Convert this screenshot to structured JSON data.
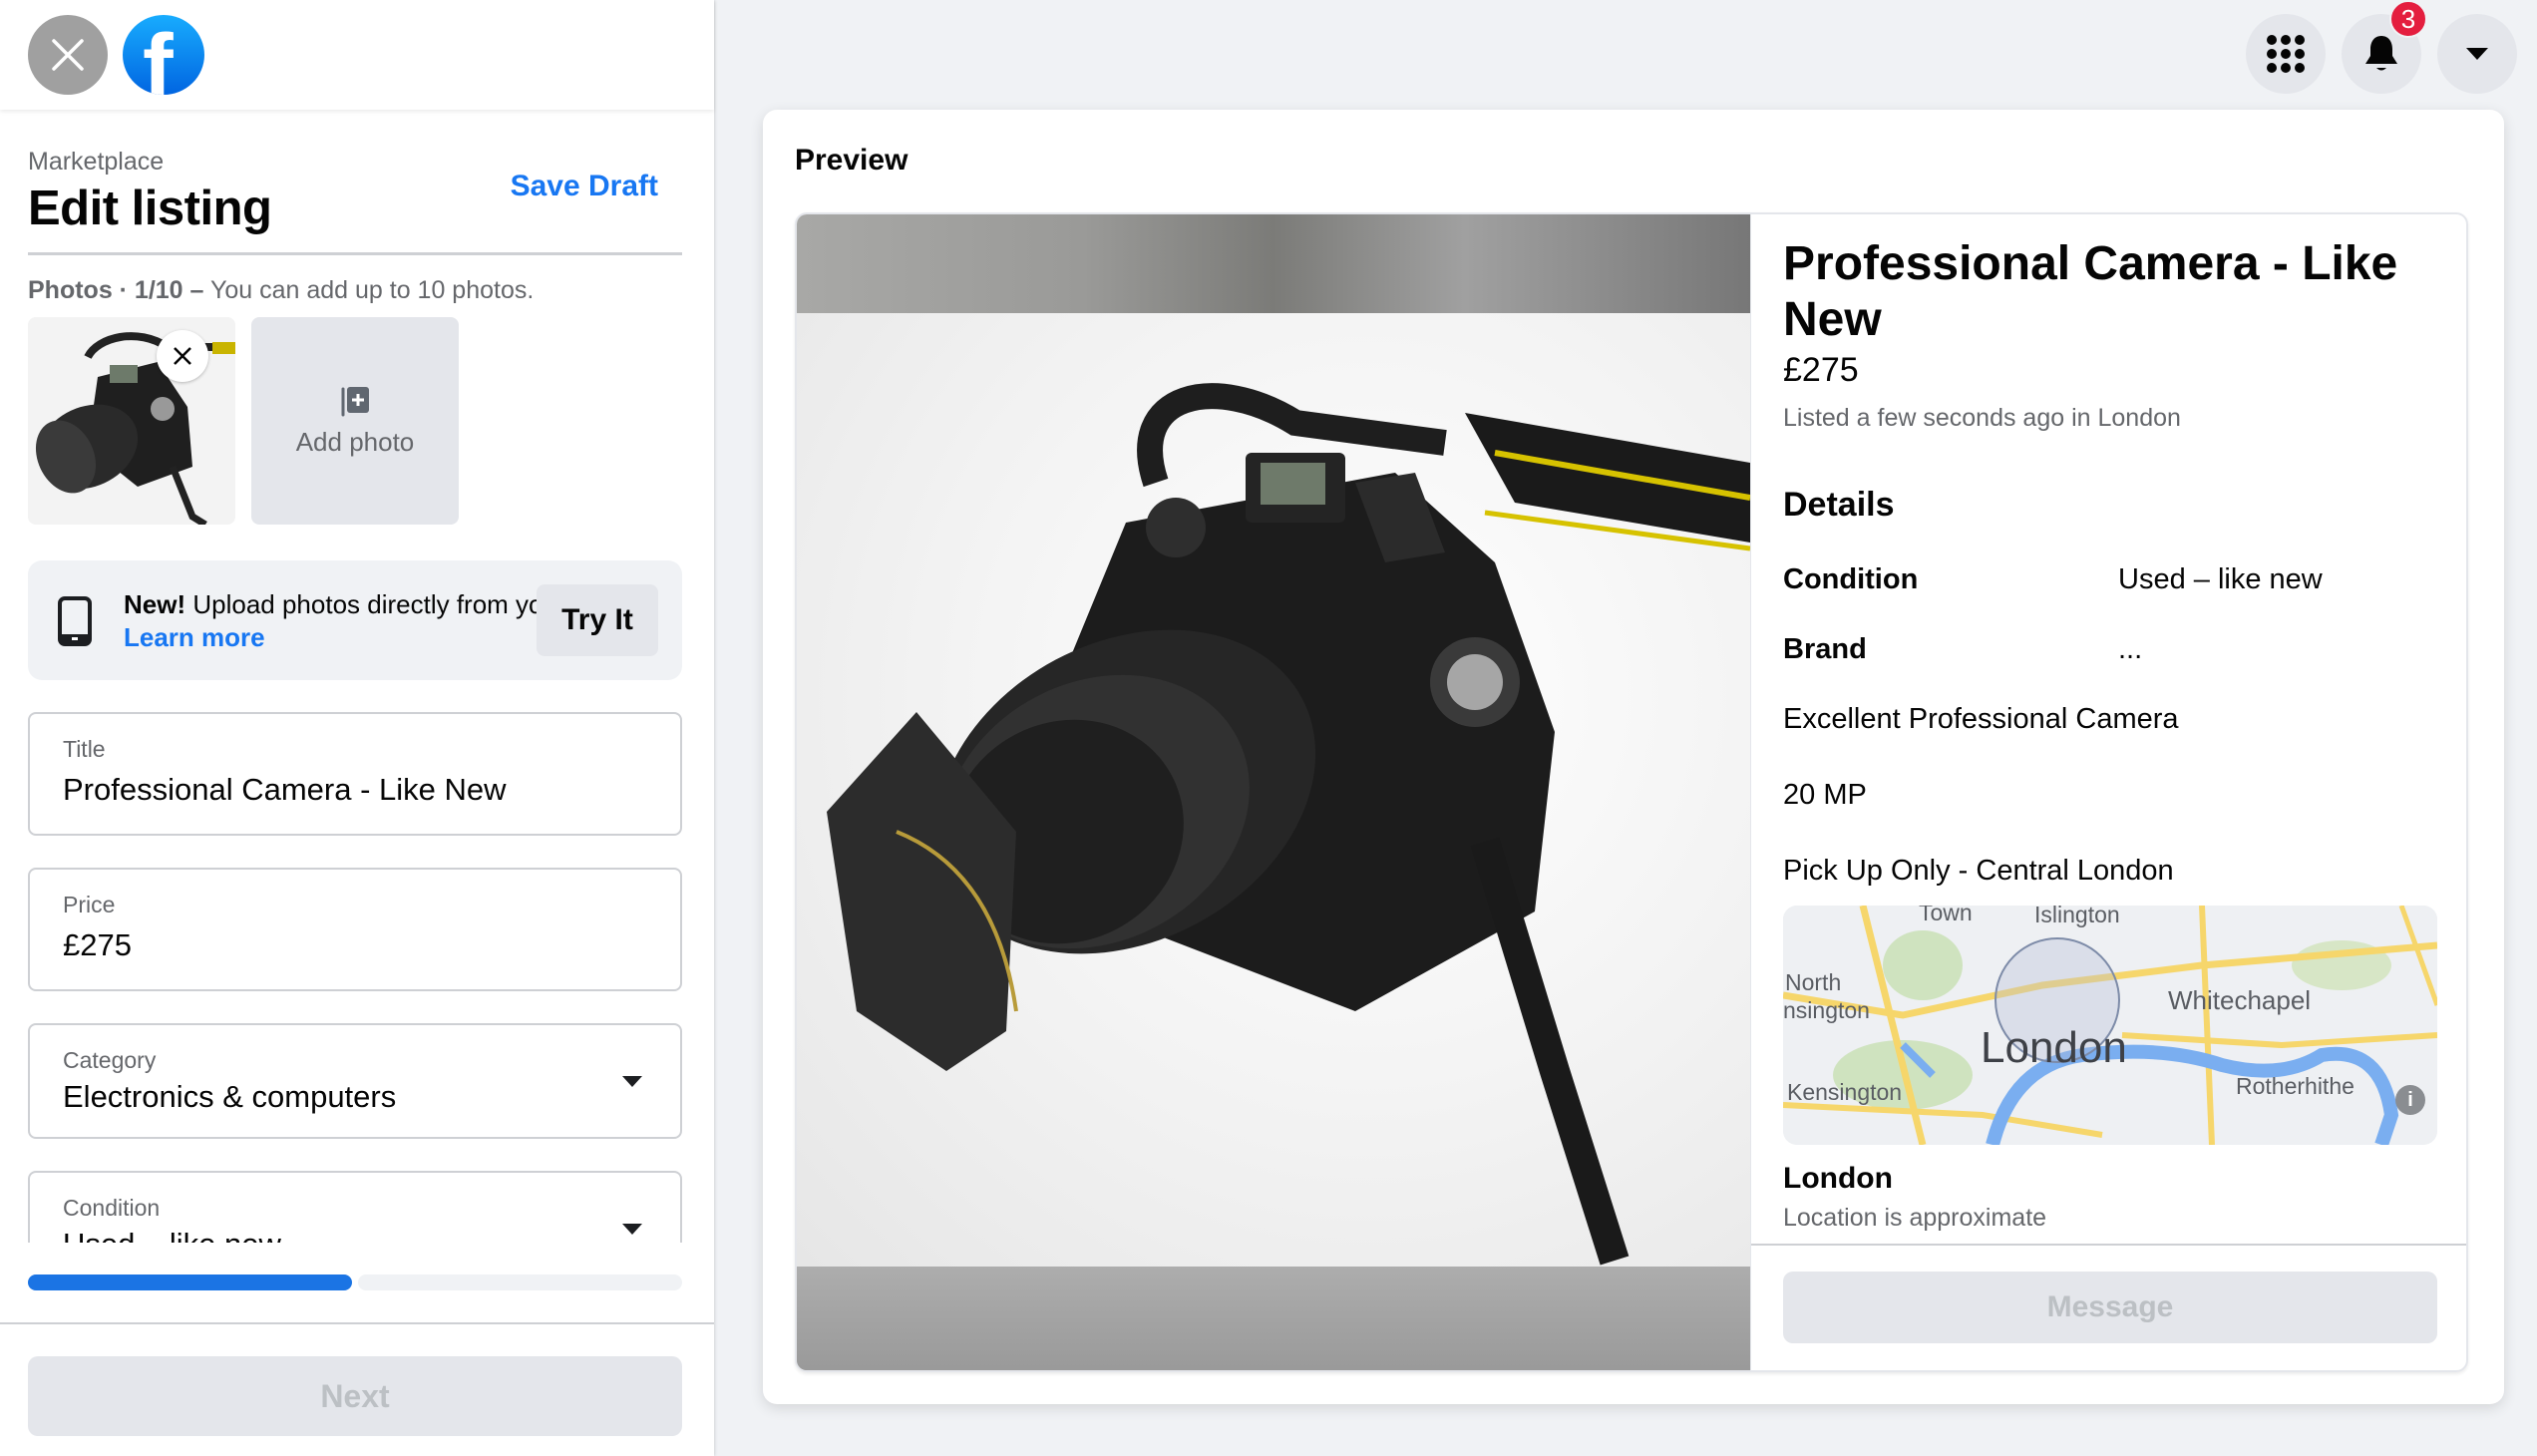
{
  "app": {
    "logo": "facebook-logo",
    "close_icon": "close-icon"
  },
  "header": {
    "breadcrumb": "Marketplace",
    "title": "Edit listing",
    "save_draft": "Save Draft"
  },
  "photos": {
    "label_bold": "Photos · 1/10 –",
    "label_rest": " You can add up to 10 photos.",
    "count": 1,
    "max": 10,
    "add_photo_label": "Add photo"
  },
  "promo": {
    "new_label": "New!",
    "text": " Upload photos directly from your phone.",
    "learn_more": "Learn more",
    "try_it": "Try It"
  },
  "form": {
    "title": {
      "label": "Title",
      "value": "Professional Camera - Like New"
    },
    "price": {
      "label": "Price",
      "value": "£275"
    },
    "category": {
      "label": "Category",
      "value": "Electronics & computers"
    },
    "condition": {
      "label": "Condition",
      "value": "Used – like new"
    }
  },
  "progress": {
    "current_step": 1,
    "total_steps": 2,
    "percent": 50
  },
  "footer": {
    "next": "Next"
  },
  "topnav": {
    "menu_icon": "grid-menu-icon",
    "notifications_icon": "bell-icon",
    "notifications_count": "3",
    "account_icon": "caret-down-icon"
  },
  "preview": {
    "heading": "Preview",
    "title": "Professional Camera - Like New",
    "price": "£275",
    "listed": "Listed a few seconds ago in London",
    "details_heading": "Details",
    "details": [
      {
        "key": "Condition",
        "value": "Used – like new"
      },
      {
        "key": "Brand",
        "value": "..."
      }
    ],
    "description": [
      "Excellent Professional Camera",
      "20 MP",
      "Pick Up Only - Central London"
    ],
    "map": {
      "labels": [
        "Town",
        "Islington",
        "North",
        "nsington",
        "Whitechapel",
        "Kensington",
        "Rotherhithe"
      ],
      "city": "London",
      "info_icon": "i"
    },
    "location_name": "London",
    "location_note": "Location is approximate",
    "message_button": "Message"
  },
  "colors": {
    "accent": "#1877f2",
    "progress": "#1b74e4",
    "badge": "#e41e3f"
  }
}
